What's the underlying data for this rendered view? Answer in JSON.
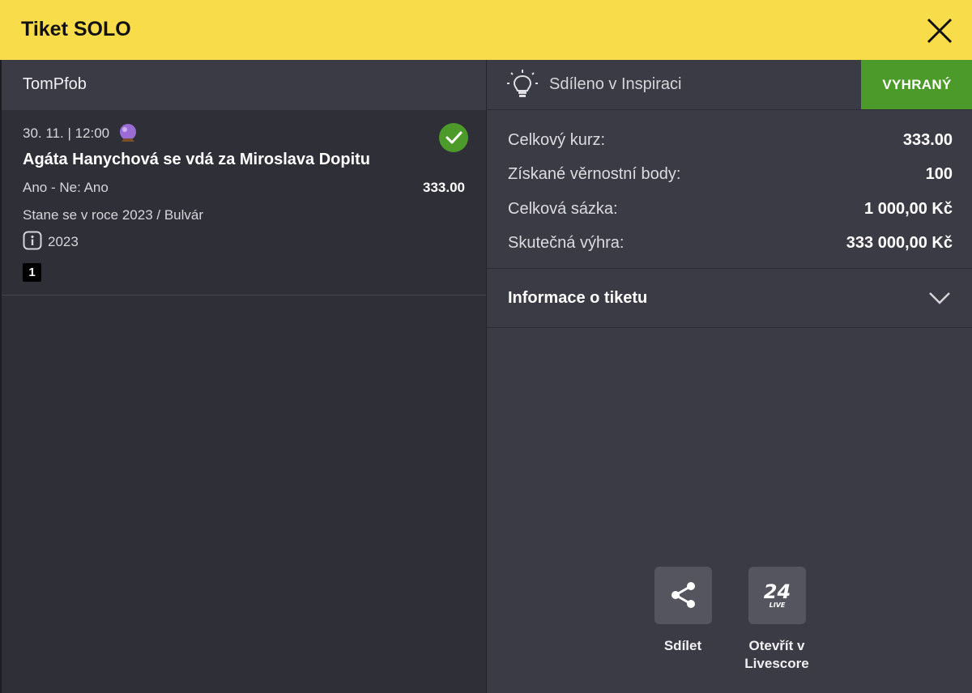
{
  "header": {
    "title": "Tiket SOLO",
    "close_icon": "close-icon"
  },
  "user": {
    "name": "TomPfob"
  },
  "event": {
    "datetime": "30. 11. | 12:00",
    "name": "Agáta Hanychová se vdá za Miroslava Dopitu",
    "selection": "Ano - Ne: Ano",
    "odds": "333.00",
    "category": "Stane se v roce 2023 / Bulvár",
    "info": "2023",
    "badge": "1",
    "status_icon": "check-circle-icon",
    "type_icon": "crystal-ball-icon"
  },
  "shared": {
    "label": "Sdíleno v Inspiraci",
    "icon": "lightbulb-icon"
  },
  "status": {
    "label": "VYHRANÝ",
    "color": "#4c9a2a"
  },
  "stats": [
    {
      "label": "Celkový kurz:",
      "value": "333.00"
    },
    {
      "label": "Získané věrnostní body:",
      "value": "100"
    },
    {
      "label": "Celková sázka:",
      "value": "1 000,00 Kč"
    },
    {
      "label": "Skutečná výhra:",
      "value": "333 000,00 Kč"
    }
  ],
  "ticket_info": {
    "label": "Informace o tiketu"
  },
  "actions": {
    "share": {
      "label": "Sdílet",
      "icon": "share-icon"
    },
    "livescore": {
      "label_line1": "Otevřít v",
      "label_line2": "Livescore",
      "icon": "live24-icon",
      "icon_text": "24",
      "icon_subtext": "LIVE"
    }
  },
  "colors": {
    "accent": "#f8dc4a",
    "win": "#4c9a2a",
    "panel": "#3a3b44",
    "background": "#2e2f37"
  }
}
